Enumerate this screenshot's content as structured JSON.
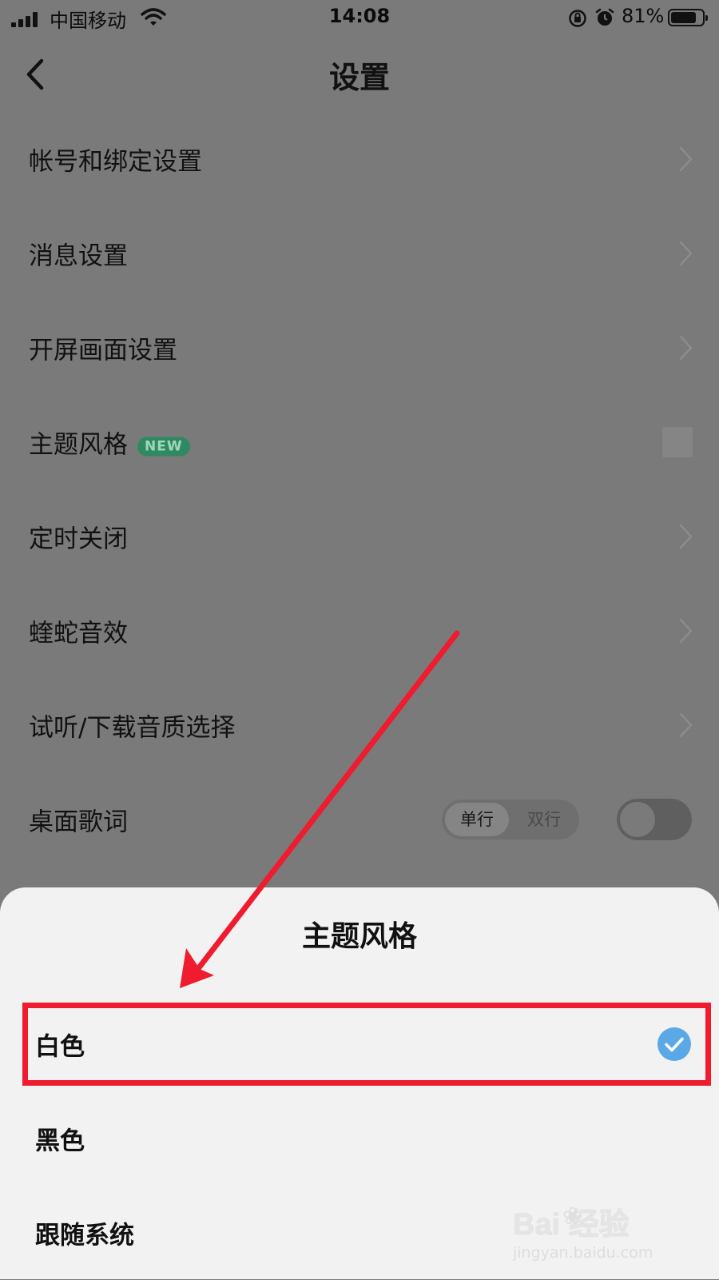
{
  "status_bar": {
    "carrier": "中国移动",
    "time": "14:08",
    "battery_percent": "81%",
    "battery_level": 0.81,
    "icons": [
      "signal-icon",
      "wifi-icon",
      "rotation-lock-icon",
      "alarm-icon",
      "battery-icon"
    ]
  },
  "nav": {
    "title": "设置",
    "back_icon": "chevron-left-icon"
  },
  "settings": {
    "items": [
      {
        "label": "帐号和绑定设置",
        "accessory": "chevron-right-icon"
      },
      {
        "label": "消息设置",
        "accessory": "chevron-right-icon"
      },
      {
        "label": "开屏画面设置",
        "accessory": "chevron-right-icon"
      },
      {
        "label": "主题风格",
        "badge": "NEW",
        "accessory": "theme-preview"
      },
      {
        "label": "定时关闭",
        "accessory": "chevron-right-icon"
      },
      {
        "label": "蝰蛇音效",
        "accessory": "chevron-right-icon"
      },
      {
        "label": "试听/下载音质选择",
        "accessory": "chevron-right-icon"
      },
      {
        "label": "桌面歌词",
        "segment": [
          "单行",
          "双行"
        ],
        "segment_selected": "单行",
        "toggle_on": false
      }
    ]
  },
  "sheet": {
    "title": "主题风格",
    "options": [
      {
        "label": "白色",
        "selected": true
      },
      {
        "label": "黑色",
        "selected": false
      },
      {
        "label": "跟随系统",
        "selected": false
      }
    ]
  },
  "watermark": {
    "main": "Bai  经验",
    "sub": "jingyan.baidu.com"
  },
  "colors": {
    "overlay_bg": "#7a7a7a",
    "sheet_bg": "#f2f2f2",
    "annotation_red": "#ee1c2e",
    "check_blue": "#5aa9e6",
    "badge_green": "#2f8a63"
  }
}
